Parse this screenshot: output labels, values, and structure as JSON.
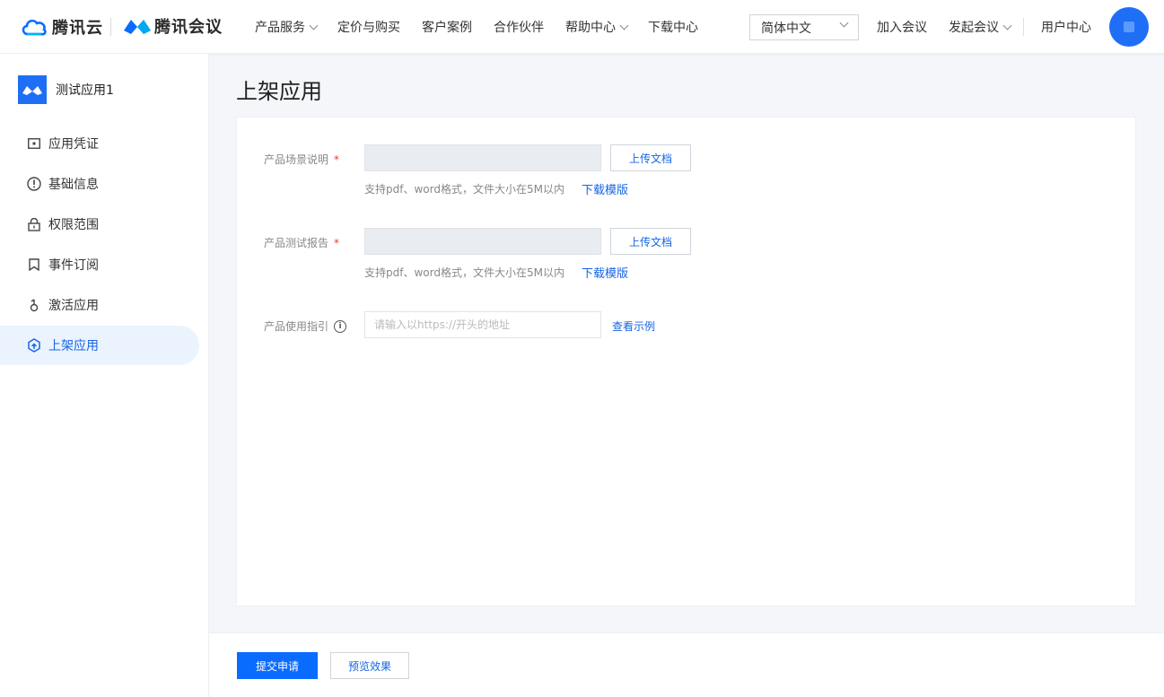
{
  "header": {
    "brand_cloud": "腾讯云",
    "brand_meeting": "腾讯会议",
    "nav": [
      {
        "label": "产品服务",
        "has_dropdown": true
      },
      {
        "label": "定价与购买",
        "has_dropdown": false
      },
      {
        "label": "客户案例",
        "has_dropdown": false
      },
      {
        "label": "合作伙伴",
        "has_dropdown": false
      },
      {
        "label": "帮助中心",
        "has_dropdown": true
      },
      {
        "label": "下载中心",
        "has_dropdown": false
      }
    ],
    "language": "简体中文",
    "join_meeting": "加入会议",
    "start_meeting": "发起会议",
    "user_center": "用户中心"
  },
  "sidebar": {
    "app_name": "测试应用1",
    "items": [
      {
        "label": "应用凭证",
        "icon": "credential-icon",
        "active": false
      },
      {
        "label": "基础信息",
        "icon": "info-circle-icon",
        "active": false
      },
      {
        "label": "权限范围",
        "icon": "lock-icon",
        "active": false
      },
      {
        "label": "事件订阅",
        "icon": "bookmark-icon",
        "active": false
      },
      {
        "label": "激活应用",
        "icon": "activate-icon",
        "active": false
      },
      {
        "label": "上架应用",
        "icon": "publish-icon",
        "active": true
      }
    ]
  },
  "main": {
    "title": "上架应用",
    "form": {
      "scene": {
        "label": "产品场景说明",
        "required": "*",
        "upload_label": "上传文档",
        "hint": "支持pdf、word格式，文件大小在5M以内",
        "template_link": "下载模版"
      },
      "report": {
        "label": "产品测试报告",
        "required": "*",
        "upload_label": "上传文档",
        "hint": "支持pdf、word格式，文件大小在5M以内",
        "template_link": "下载模版"
      },
      "guide": {
        "label": "产品使用指引",
        "value": "",
        "placeholder": "请输入以https://开头的地址",
        "example_link": "查看示例"
      }
    }
  },
  "footer": {
    "submit_label": "提交申请",
    "preview_label": "预览效果"
  },
  "colors": {
    "primary": "#0a6cff",
    "link": "#1565e6",
    "required": "#e53935",
    "active_bg": "#ebf3fe"
  }
}
